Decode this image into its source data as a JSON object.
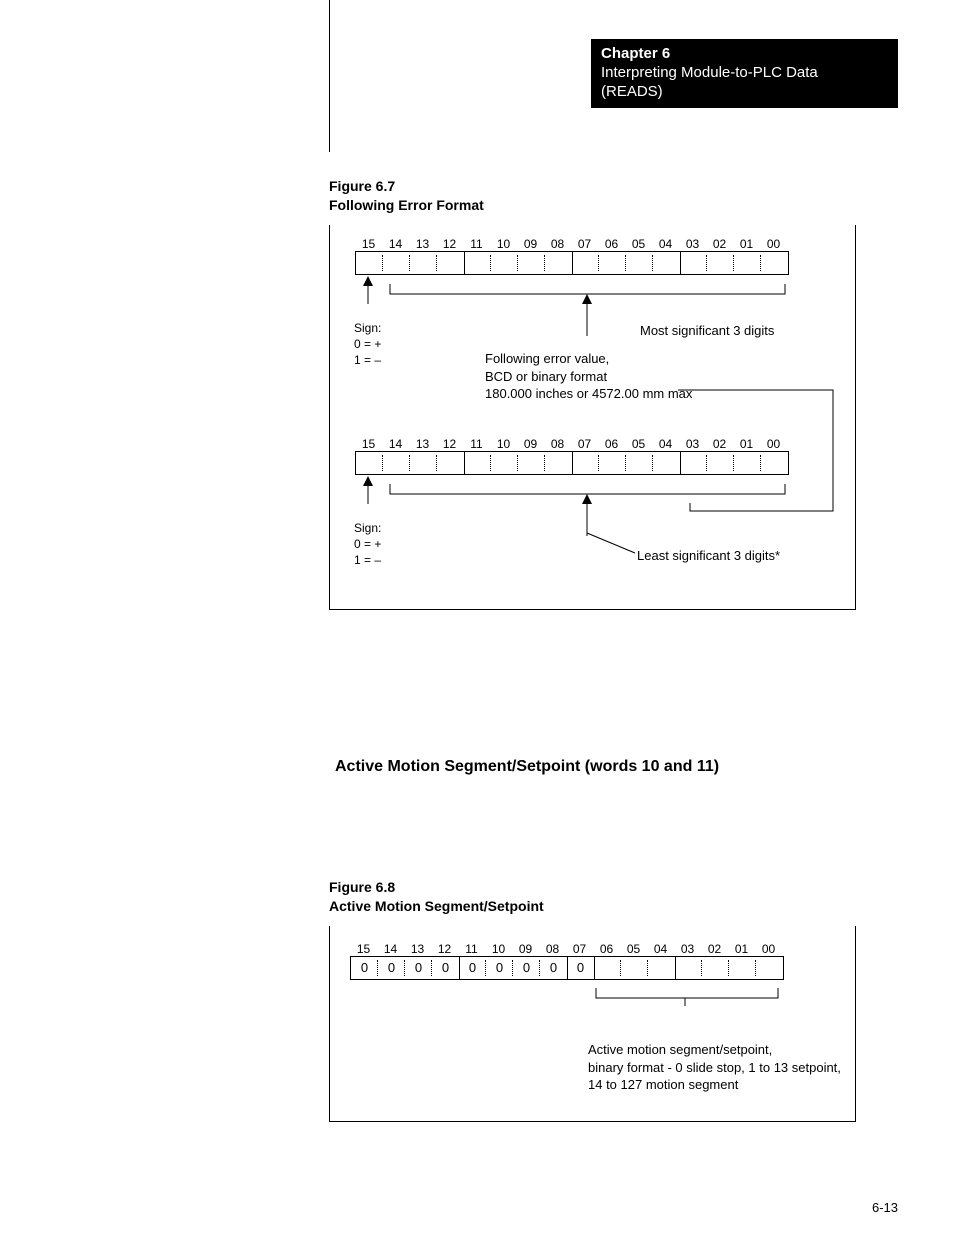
{
  "header": {
    "chapter": "Chapter 6",
    "title_line1": "Interpreting Module-to-PLC Data",
    "title_line2": "(READS)"
  },
  "figure67": {
    "label_line1": "Figure 6.7",
    "label_line2": "Following Error Format",
    "bits": [
      "15",
      "14",
      "13",
      "12",
      "11",
      "10",
      "09",
      "08",
      "07",
      "06",
      "05",
      "04",
      "03",
      "02",
      "01",
      "00"
    ],
    "sign_label": "Sign:",
    "sign_plus": "0 = +",
    "sign_minus": "1 = –",
    "center_line1": "Following error value,",
    "center_line2": "BCD or binary format",
    "center_line3": "180.000 inches or 4572.00 mm max",
    "most_sig": "Most significant 3 digits",
    "least_sig": "Least significant 3 digits*"
  },
  "section": {
    "heading": "Active Motion Segment/Setpoint (words 10 and 11)"
  },
  "figure68": {
    "label_line1": "Figure 6.8",
    "label_line2": "Active Motion Segment/Setpoint",
    "bits": [
      "15",
      "14",
      "13",
      "12",
      "11",
      "10",
      "09",
      "08",
      "07",
      "06",
      "05",
      "04",
      "03",
      "02",
      "01",
      "00"
    ],
    "values": [
      "0",
      "0",
      "0",
      "0",
      "0",
      "0",
      "0",
      "0",
      "0",
      "",
      "",
      "",
      "",
      "",
      "",
      ""
    ],
    "anno_line1": "Active motion segment/setpoint,",
    "anno_line2": "binary format - 0 slide stop, 1 to 13 setpoint,",
    "anno_line3": "14 to 127 motion segment"
  },
  "page_number": "6-13"
}
